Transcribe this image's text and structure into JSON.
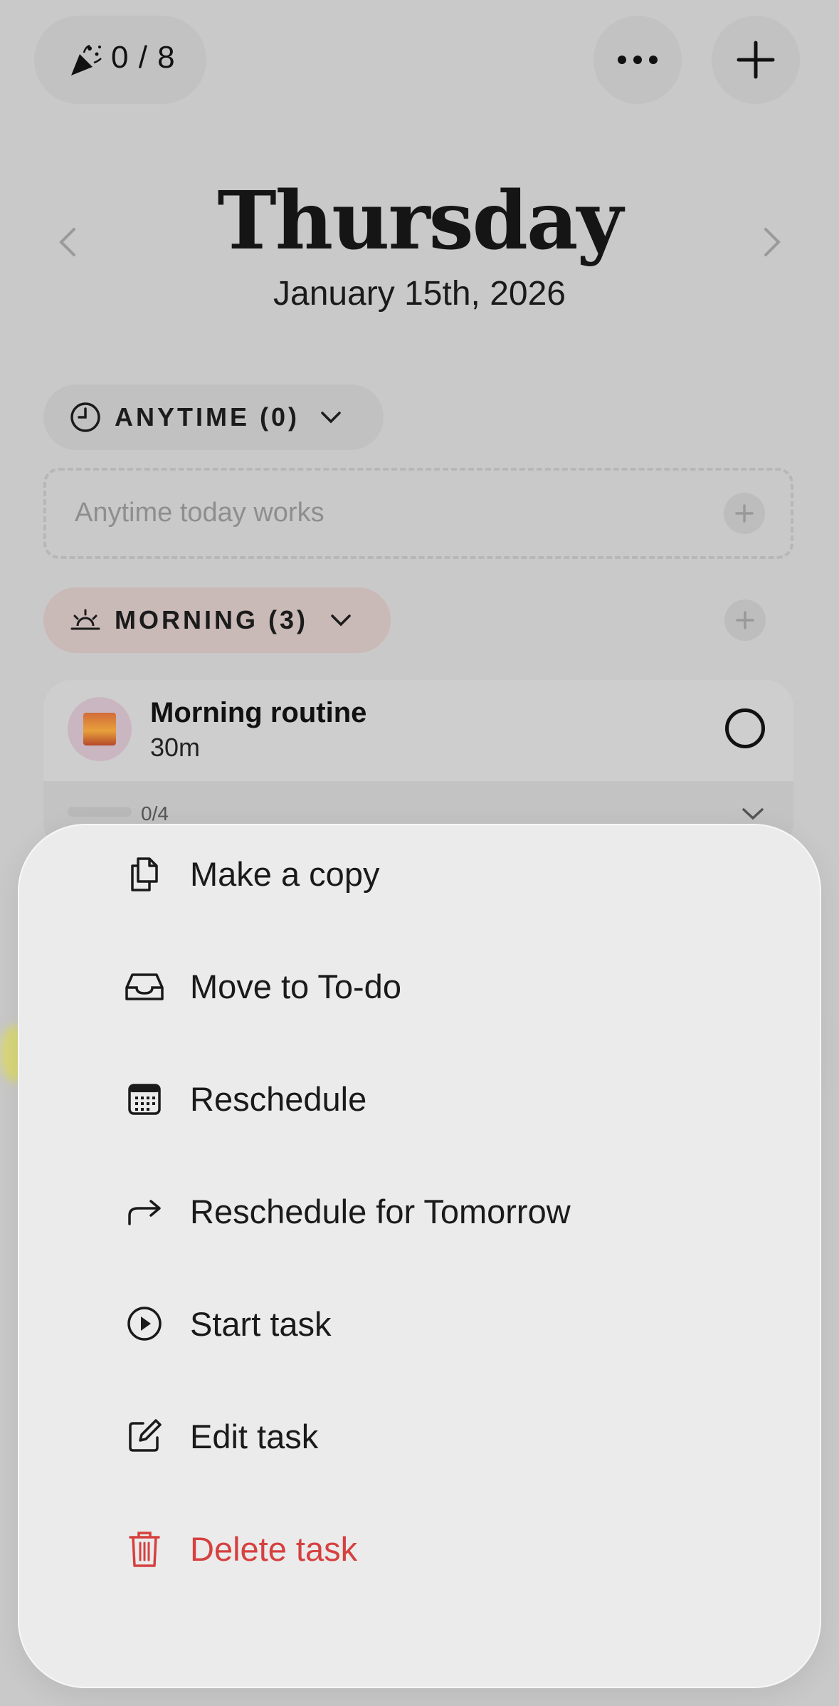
{
  "top_bar": {
    "counter_text": "0 / 8",
    "icons": [
      "party-popper-icon",
      "ellipsis-icon",
      "plus-icon"
    ]
  },
  "header": {
    "day": "Thursday",
    "date": "January 15th, 2026"
  },
  "sections": {
    "anytime": {
      "label": "ANYTIME (0)",
      "placeholder": "Anytime today works"
    },
    "morning": {
      "label": "MORNING (3)",
      "accent": "#c9b9b7"
    }
  },
  "task": {
    "title": "Morning routine",
    "duration": "30m",
    "progress": "0/4",
    "progress_fraction": 0
  },
  "action_sheet": {
    "items": [
      {
        "label": "Make a copy",
        "icon": "copy-icon"
      },
      {
        "label": "Move to To-do",
        "icon": "inbox-icon"
      },
      {
        "label": "Reschedule",
        "icon": "calendar-icon"
      },
      {
        "label": "Reschedule for Tomorrow",
        "icon": "forward-arrow-icon"
      },
      {
        "label": "Start task",
        "icon": "play-circle-icon"
      },
      {
        "label": "Edit task",
        "icon": "edit-icon"
      },
      {
        "label": "Delete task",
        "icon": "trash-icon",
        "color": "#d6403f"
      }
    ]
  }
}
